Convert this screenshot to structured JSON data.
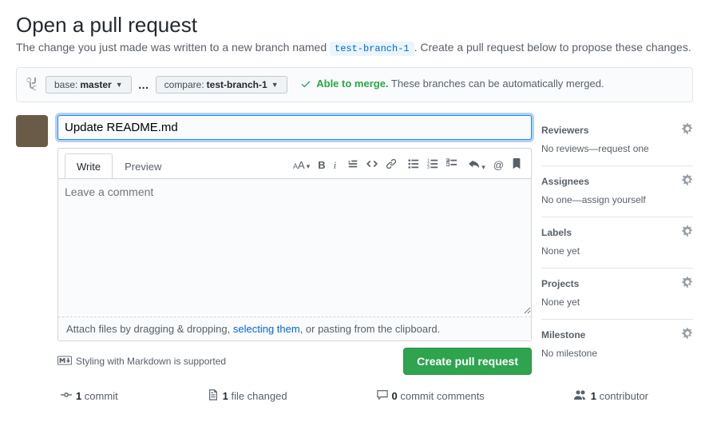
{
  "header": {
    "title": "Open a pull request",
    "subheading_pre": "The change you just made was written to a new branch named ",
    "branch_name": "test-branch-1",
    "subheading_post": ". Create a pull request below to propose these changes."
  },
  "compare": {
    "base_prefix": "base: ",
    "base_branch": "master",
    "compare_prefix": "compare: ",
    "compare_branch": "test-branch-1",
    "able_label": "Able to merge.",
    "able_detail": "These branches can be automatically merged."
  },
  "form": {
    "title_value": "Update README.md",
    "tab_write": "Write",
    "tab_preview": "Preview",
    "comment_placeholder": "Leave a comment",
    "attach_pre": "Attach files by dragging & dropping, ",
    "attach_link": "selecting them",
    "attach_post": ", or pasting from the clipboard.",
    "markdown_hint": "Styling with Markdown is supported",
    "submit_label": "Create pull request"
  },
  "toolbar": {
    "text_size": "AA",
    "bold": "B",
    "italic": "i",
    "quote": "❝",
    "code": "<>",
    "link": "🔗",
    "ul": "•≡",
    "ol": "1≡",
    "task": "✓≡",
    "reply": "↩",
    "mention": "@",
    "bookmark": "▮"
  },
  "sidebar": {
    "reviewers": {
      "title": "Reviewers",
      "value": "No reviews—request one"
    },
    "assignees": {
      "title": "Assignees",
      "value_pre": "No one—",
      "value_link": "assign yourself"
    },
    "labels": {
      "title": "Labels",
      "value": "None yet"
    },
    "projects": {
      "title": "Projects",
      "value": "None yet"
    },
    "milestone": {
      "title": "Milestone",
      "value": "No milestone"
    }
  },
  "stats": {
    "commits_count": "1",
    "commits_label": " commit",
    "files_count": "1",
    "files_label": " file changed",
    "comments_count": "0",
    "comments_label": " commit comments",
    "contributors_count": "1",
    "contributors_label": " contributor"
  }
}
